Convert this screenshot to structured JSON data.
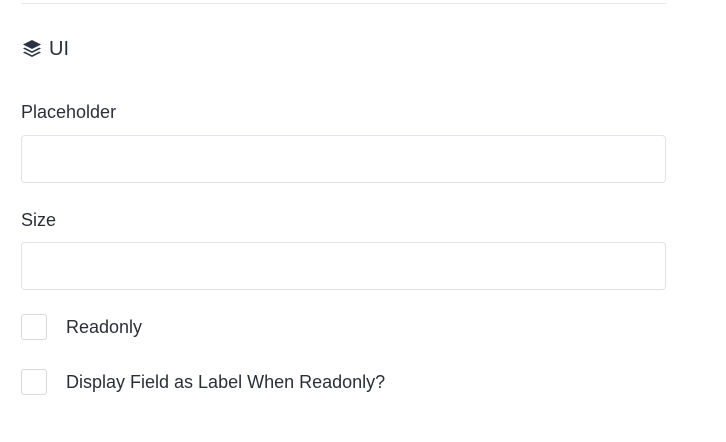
{
  "section": {
    "title": "UI",
    "icon": "layers-icon"
  },
  "fields": {
    "placeholder": {
      "label": "Placeholder",
      "value": "",
      "placeholder": ""
    },
    "size": {
      "label": "Size",
      "value": "",
      "placeholder": ""
    }
  },
  "checkboxes": {
    "readonly": {
      "label": "Readonly",
      "checked": false
    },
    "display_as_label": {
      "label": "Display Field as Label When Readonly?",
      "checked": false
    }
  },
  "colors": {
    "text": "#2b2f36",
    "border": "#e0e3e8",
    "icon": "#2b3345"
  }
}
